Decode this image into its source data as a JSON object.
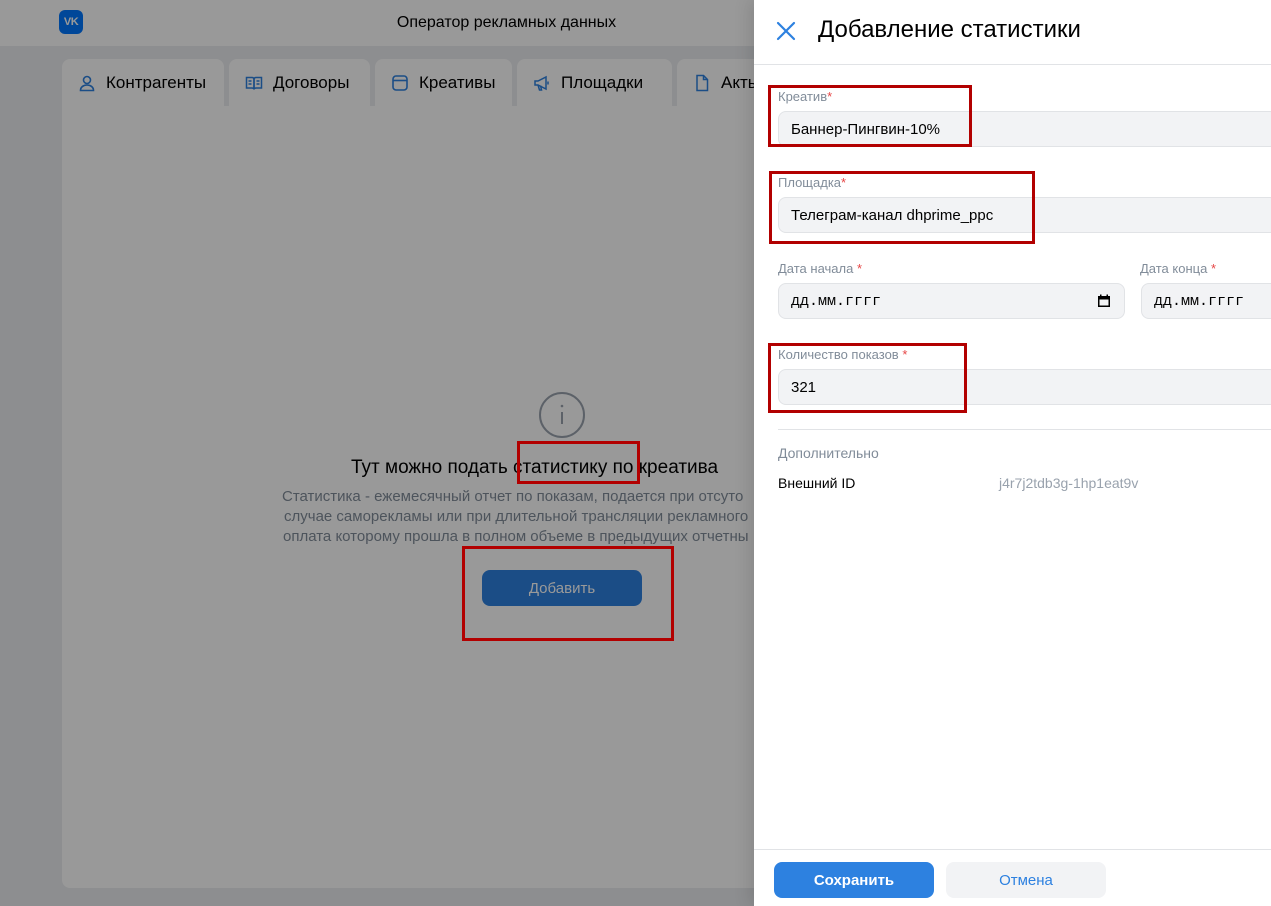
{
  "app": {
    "title": "Оператор рекламных данных",
    "logo": "VK"
  },
  "tabs": [
    {
      "label": "Контрагенты",
      "icon": "person-icon"
    },
    {
      "label": "Договоры",
      "icon": "book-icon"
    },
    {
      "label": "Креативы",
      "icon": "window-icon"
    },
    {
      "label": "Площадки",
      "icon": "megaphone-icon"
    },
    {
      "label": "Акты",
      "icon": "document-icon"
    }
  ],
  "empty_state": {
    "icon": "info-icon",
    "title": "Тут можно подать статистику по креатива",
    "desc_lines": [
      "Статистика - ежемесячный отчет по показам, подается при отсуто",
      "случае саморекламы или при длительной трансляции рекламного",
      "оплата которому прошла в полном объеме в предыдущих отчетны"
    ],
    "add_label": "Добавить"
  },
  "panel": {
    "title": "Добавление статистики",
    "creative": {
      "label": "Креатив",
      "value": "Баннер-Пингвин-10%"
    },
    "platform": {
      "label": "Площадка",
      "value": "Телеграм-канал dhprime_ppc"
    },
    "date_start": {
      "label": "Дата начала",
      "placeholder": "дд.мм.гггг"
    },
    "date_end": {
      "label": "Дата конца",
      "placeholder": "дд.мм.гггг"
    },
    "impressions": {
      "label": "Количество показов",
      "value": "321"
    },
    "required_mark": "*",
    "extra": {
      "title": "Дополнительно",
      "external_id_label": "Внешний ID",
      "external_id_value": "j4r7j2tdb3g-1hp1eat9v"
    },
    "save_label": "Сохранить",
    "cancel_label": "Отмена"
  },
  "colors": {
    "accent": "#2d81e0",
    "annotation": "#b20000",
    "required": "#e64646"
  }
}
